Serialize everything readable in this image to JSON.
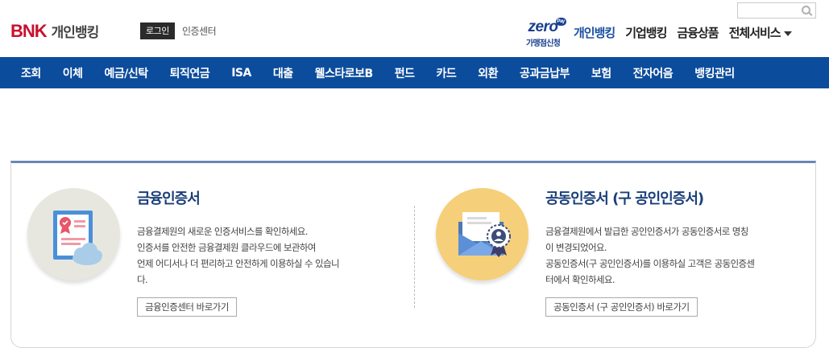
{
  "header": {
    "logo_mark": "BNK",
    "logo_text": "개인뱅킹",
    "login_label": "로그인",
    "cert_center_label": "인증센터",
    "zero_pay": {
      "word": "zero",
      "badge": "Pay",
      "sub": "가맹점신청"
    },
    "top_nav": [
      {
        "label": "개인뱅킹",
        "active": true
      },
      {
        "label": "기업뱅킹",
        "active": false
      },
      {
        "label": "금융상품",
        "active": false
      },
      {
        "label": "전체서비스",
        "active": false
      }
    ]
  },
  "gnb": {
    "items": [
      "조회",
      "이체",
      "예금/신탁",
      "퇴직연금",
      "ISA",
      "대출",
      "웰스타로보B",
      "펀드",
      "카드",
      "외환",
      "공과금납부",
      "보험",
      "전자어음",
      "뱅킹관리"
    ]
  },
  "panels": {
    "financial_cert": {
      "title": "금융인증서",
      "lines": [
        "금융결제원의 새로운 인증서비스를 확인하세요.",
        "인증서를 안전한 금융결제원 클라우드에 보관하여",
        "언제 어디서나 더 편리하고 안전하게 이용하실 수 있습니",
        "다."
      ],
      "button": "금융인증센터 바로가기"
    },
    "joint_cert": {
      "title": "공동인증서 (구 공인인증서)",
      "lines": [
        "금융결제원에서 발급한 공인인증서가 공동인증서로 명칭",
        "이 변경되었어요.",
        "공동인증서(구 공인인증서)를 이용하실 고객은 공동인증센",
        "터에서 확인하세요."
      ],
      "button": "공동인증서 (구 공인인증서) 바로가기"
    }
  },
  "colors": {
    "gnb_bg": "#0c4c9c",
    "brand_red": "#c8102e",
    "title_blue": "#1a3f7a"
  },
  "icons": {
    "search": "search-icon",
    "cert_document": "certificate-document-icon",
    "cloud": "cloud-icon",
    "envelope": "envelope-icon",
    "badge": "award-badge-icon",
    "dropdown": "chevron-down-icon"
  }
}
